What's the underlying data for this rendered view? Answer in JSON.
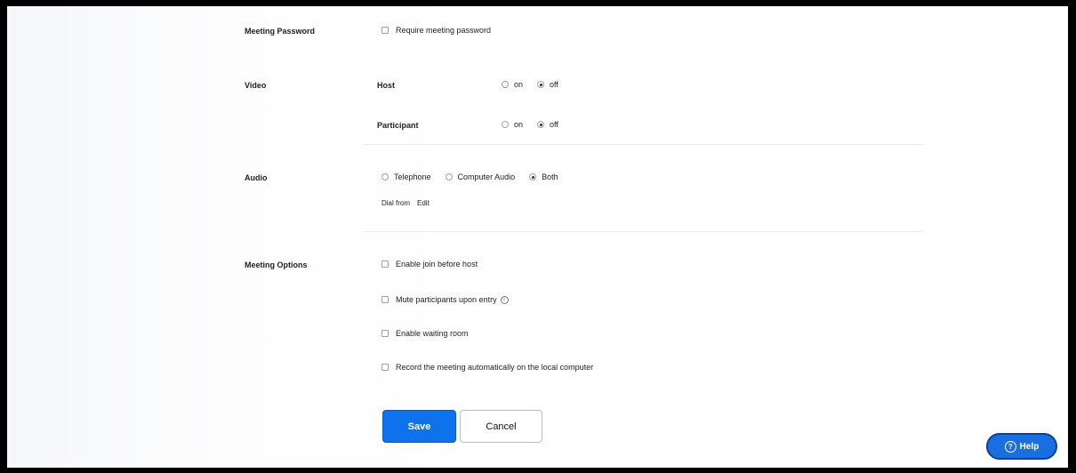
{
  "meeting_password": {
    "label": "Meeting Password",
    "require_label": "Require meeting password"
  },
  "video": {
    "label": "Video",
    "host_label": "Host",
    "participant_label": "Participant",
    "on_label": "on",
    "off_label": "off",
    "host_value": "off",
    "participant_value": "off"
  },
  "audio": {
    "label": "Audio",
    "options": [
      "Telephone",
      "Computer Audio",
      "Both"
    ],
    "selected": "Both",
    "dial_from_label": "Dial from",
    "edit_label": "Edit"
  },
  "meeting_options": {
    "label": "Meeting Options",
    "join_before_host": "Enable join before host",
    "mute_on_entry": "Mute participants upon entry",
    "waiting_room": "Enable waiting room",
    "auto_record": "Record the meeting automatically on the local computer"
  },
  "buttons": {
    "save": "Save",
    "cancel": "Cancel"
  },
  "help": {
    "label": "Help",
    "icon_glyph": "?"
  }
}
